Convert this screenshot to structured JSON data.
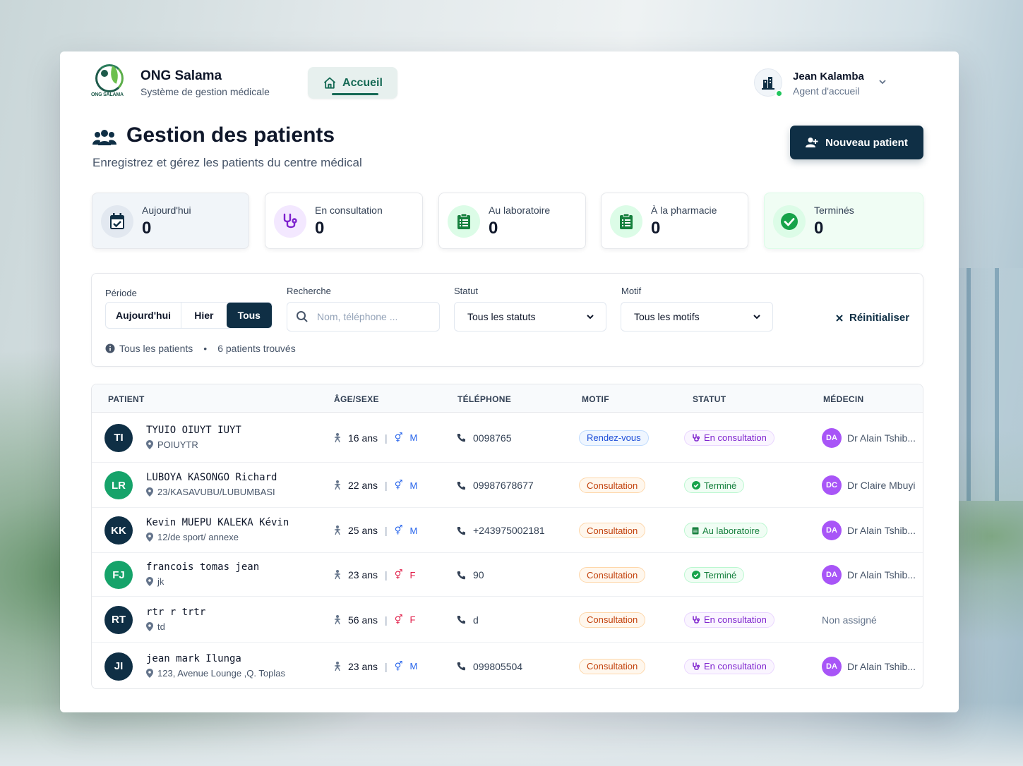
{
  "brand": {
    "name": "ONG Salama",
    "subtitle": "Système de gestion médicale",
    "logo_text": "ONG SALAMA"
  },
  "nav": {
    "home_label": "Accueil"
  },
  "user": {
    "name": "Jean Kalamba",
    "role": "Agent d'accueil",
    "status": "online"
  },
  "page": {
    "title": "Gestion des patients",
    "subtitle": "Enregistrez et gérez les patients du centre médical",
    "new_button": "Nouveau patient"
  },
  "stats": [
    {
      "label": "Aujourd'hui",
      "value": "0",
      "icon": "calendar-check-icon",
      "color": "#0f2f45"
    },
    {
      "label": "En consultation",
      "value": "0",
      "icon": "stethoscope-icon",
      "color": "#7e22ce"
    },
    {
      "label": "Au laboratoire",
      "value": "0",
      "icon": "clipboard-list-icon",
      "color": "#15803d"
    },
    {
      "label": "À la pharmacie",
      "value": "0",
      "icon": "clipboard-list-icon",
      "color": "#15803d"
    },
    {
      "label": "Terminés",
      "value": "0",
      "icon": "check-circle-icon",
      "color": "#15803d"
    }
  ],
  "filters": {
    "period_label": "Période",
    "period_options": [
      "Aujourd'hui",
      "Hier",
      "Tous"
    ],
    "period_selected": "Tous",
    "search_label": "Recherche",
    "search_placeholder": "Nom, téléphone ...",
    "search_value": "",
    "status_label": "Statut",
    "status_value": "Tous les statuts",
    "motif_label": "Motif",
    "motif_value": "Tous les motifs",
    "reset_label": "Réinitialiser",
    "info_scope": "Tous les patients",
    "info_count": "6 patients trouvés"
  },
  "table": {
    "headers": [
      "PATIENT",
      "ÂGE/SEXE",
      "TÉLÉPHONE",
      "MOTIF",
      "STATUT",
      "MÉDECIN"
    ],
    "rows": [
      {
        "initials": "TI",
        "avatar_color": "#0f2f45",
        "name": "TYUIO OIUYT IUYT",
        "address": "POIUYTR",
        "age": "16 ans",
        "sex": "M",
        "phone": "0098765",
        "motif": "Rendez-vous",
        "status": "En consultation",
        "doctor_initials": "DA",
        "doctor": "Dr Alain Tshib..."
      },
      {
        "initials": "LR",
        "avatar_color": "#16a36a",
        "name": "LUBOYA KASONGO Richard",
        "address": "23/KASAVUBU/LUBUMBASI",
        "age": "22 ans",
        "sex": "M",
        "phone": "09987678677",
        "motif": "Consultation",
        "status": "Terminé",
        "doctor_initials": "DC",
        "doctor": "Dr Claire Mbuyi"
      },
      {
        "initials": "KK",
        "avatar_color": "#0f2f45",
        "name": "Kevin MUEPU KALEKA Kévin",
        "address": "12/de sport/ annexe",
        "age": "25 ans",
        "sex": "M",
        "phone": "+243975002181",
        "motif": "Consultation",
        "status": "Au laboratoire",
        "doctor_initials": "DA",
        "doctor": "Dr Alain Tshib..."
      },
      {
        "initials": "FJ",
        "avatar_color": "#16a36a",
        "name": "francois tomas jean",
        "address": "jk",
        "age": "23 ans",
        "sex": "F",
        "phone": "90",
        "motif": "Consultation",
        "status": "Terminé",
        "doctor_initials": "DA",
        "doctor": "Dr Alain Tshib..."
      },
      {
        "initials": "RT",
        "avatar_color": "#0f2f45",
        "name": "rtr r trtr",
        "address": "td",
        "age": "56 ans",
        "sex": "F",
        "phone": "d",
        "motif": "Consultation",
        "status": "En consultation",
        "doctor_initials": "",
        "doctor": "Non assigné"
      },
      {
        "initials": "JI",
        "avatar_color": "#0f2f45",
        "name": "jean mark Ilunga",
        "address": "123, Avenue Lounge ,Q. Toplas",
        "age": "23 ans",
        "sex": "M",
        "phone": "099805504",
        "motif": "Consultation",
        "status": "En consultation",
        "doctor_initials": "DA",
        "doctor": "Dr Alain Tshib..."
      }
    ]
  }
}
